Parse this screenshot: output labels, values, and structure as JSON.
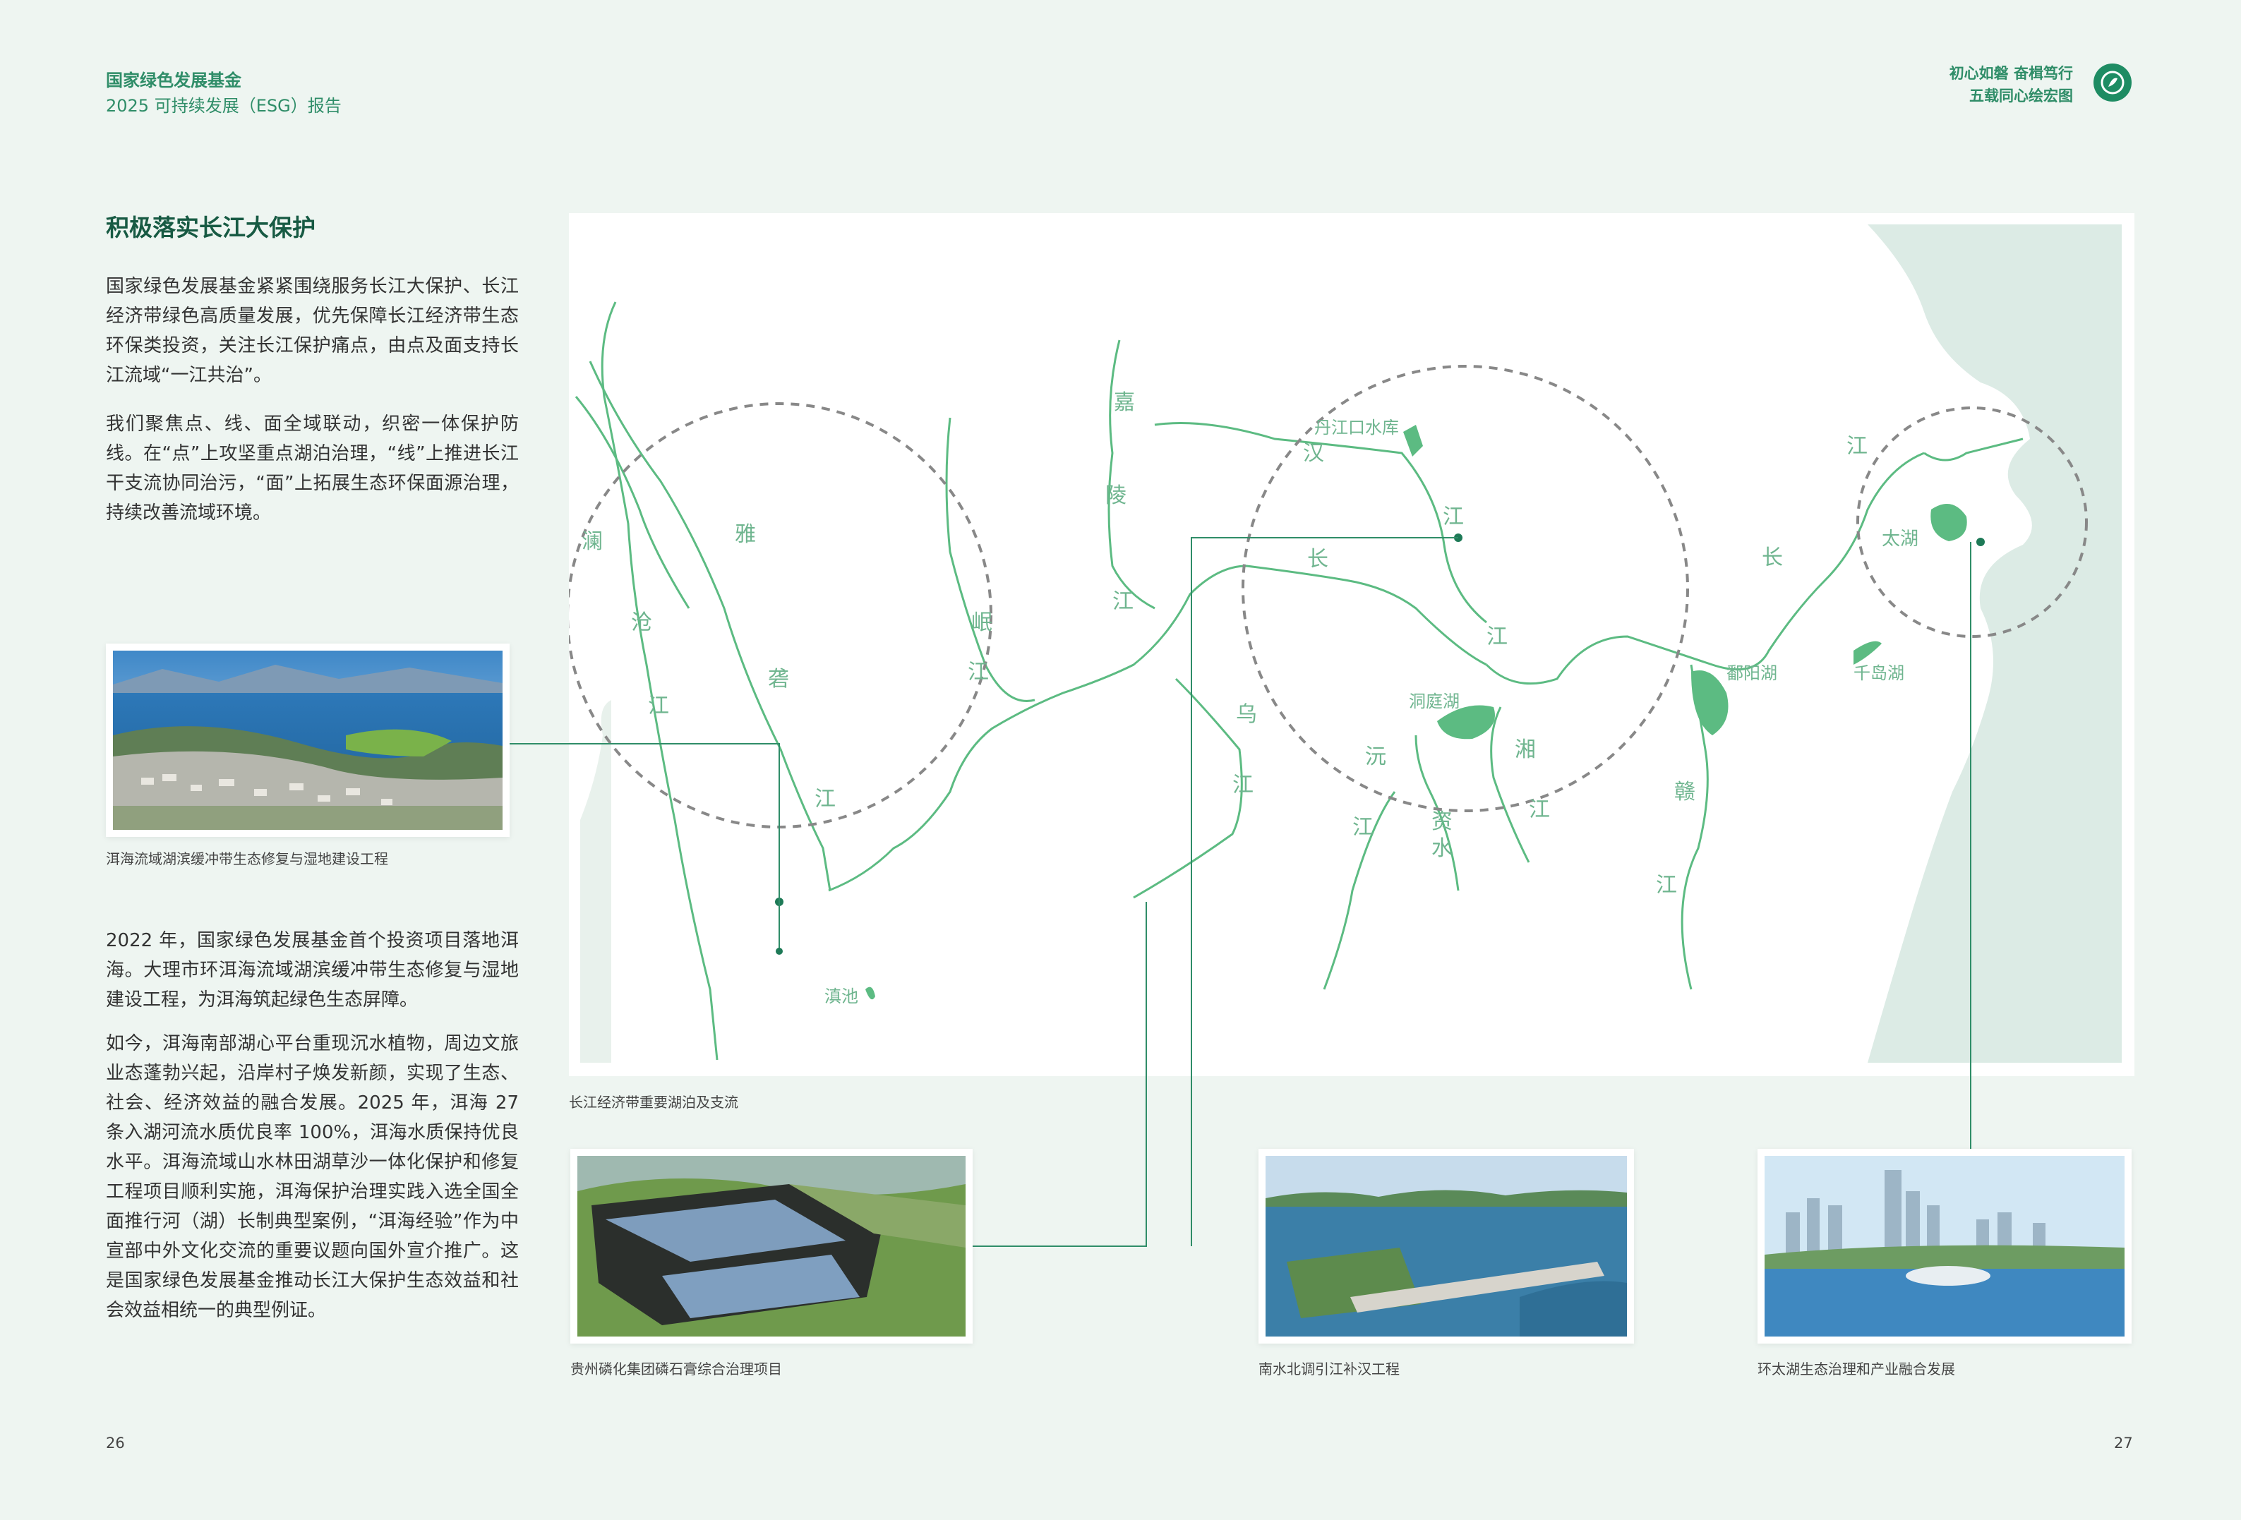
{
  "header": {
    "org": "国家绿色发展基金",
    "report": "2025 可持续发展（ESG）报告",
    "slogan_line1": "初心如磐 奋楫笃行",
    "slogan_line2": "五载同心绘宏图"
  },
  "section_title": "积极落实长江大保护",
  "intro_paragraphs": [
    "国家绿色发展基金紧紧围绕服务长江大保护、长江经济带绿色高质量发展，优先保障长江经济带生态环保类投资，关注长江保护痛点，由点及面支持长江流域“一江共治”。",
    "我们聚焦点、线、面全域联动，织密一体保护防线。在“点”上攻坚重点湖泊治理，“线”上推进长江干支流协同治污，“面”上拓展生态环保面源治理，持续改善流域环境。"
  ],
  "erhai_caption": "洱海流域湖滨缓冲带生态修复与湿地建设工程",
  "erhai_paragraphs": [
    "2022 年，国家绿色发展基金首个投资项目落地洱海。大理市环洱海流域湖滨缓冲带生态修复与湿地建设工程，为洱海筑起绿色生态屏障。",
    "如今，洱海南部湖心平台重现沉水植物，周边文旅业态蓬勃兴起，沿岸村子焕发新颜，实现了生态、社会、经济效益的融合发展。2025 年，洱海 27 条入湖河流水质优良率 100%，洱海水质保持优良水平。洱海流域山水林田湖草沙一体化保护和修复工程项目顺利实施，洱海保护治理实践入选全国全面推行河（湖）长制典型案例，“洱海经验”作为中宣部中外文化交流的重要议题向国外宣介推广。这是国家绿色发展基金推动长江大保护生态效益和社会效益相统一的典型例证。"
  ],
  "map": {
    "caption": "长江经济带重要湖泊及支流",
    "labels": [
      {
        "id": "lancang-1",
        "text": "澜"
      },
      {
        "id": "lancang-2",
        "text": "沧"
      },
      {
        "id": "lancang-3",
        "text": "江"
      },
      {
        "id": "yalong-1",
        "text": "雅"
      },
      {
        "id": "yalong-2",
        "text": "砻"
      },
      {
        "id": "yalong-3",
        "text": "江"
      },
      {
        "id": "min-1",
        "text": "岷"
      },
      {
        "id": "min-2",
        "text": "江"
      },
      {
        "id": "jialing-1",
        "text": "嘉"
      },
      {
        "id": "jialing-2",
        "text": "陵"
      },
      {
        "id": "jialing-3",
        "text": "江"
      },
      {
        "id": "wu-1",
        "text": "乌"
      },
      {
        "id": "wu-2",
        "text": "江"
      },
      {
        "id": "danjiangkou",
        "text": "丹江口水库"
      },
      {
        "id": "han-1",
        "text": "汉"
      },
      {
        "id": "han-2",
        "text": "江"
      },
      {
        "id": "chang-1",
        "text": "长"
      },
      {
        "id": "jiang-1",
        "text": "江"
      },
      {
        "id": "chang-2",
        "text": "长"
      },
      {
        "id": "jiang-2",
        "text": "江"
      },
      {
        "id": "dongting",
        "text": "洞庭湖"
      },
      {
        "id": "yuan-1",
        "text": "沅"
      },
      {
        "id": "yuan-2",
        "text": "江"
      },
      {
        "id": "zi-1",
        "text": "资"
      },
      {
        "id": "zi-2",
        "text": "水"
      },
      {
        "id": "xiang-1",
        "text": "湘"
      },
      {
        "id": "xiang-2",
        "text": "江"
      },
      {
        "id": "poyang",
        "text": "鄱阳湖"
      },
      {
        "id": "gan-1",
        "text": "赣"
      },
      {
        "id": "gan-2",
        "text": "江"
      },
      {
        "id": "qiandao",
        "text": "千岛湖"
      },
      {
        "id": "taihu",
        "text": "太湖"
      },
      {
        "id": "dianchi",
        "text": "滇池"
      }
    ]
  },
  "bottom_captions": {
    "guizhou": "贵州磷化集团磷石膏综合治理项目",
    "nsbd": "南水北调引江补汉工程",
    "taihu": "环太湖生态治理和产业融合发展"
  },
  "page_numbers": {
    "left": "26",
    "right": "27"
  },
  "colors": {
    "accent": "#2f8d68",
    "river": "#5cbb82",
    "title": "#175a43",
    "background": "#eef5f1"
  }
}
